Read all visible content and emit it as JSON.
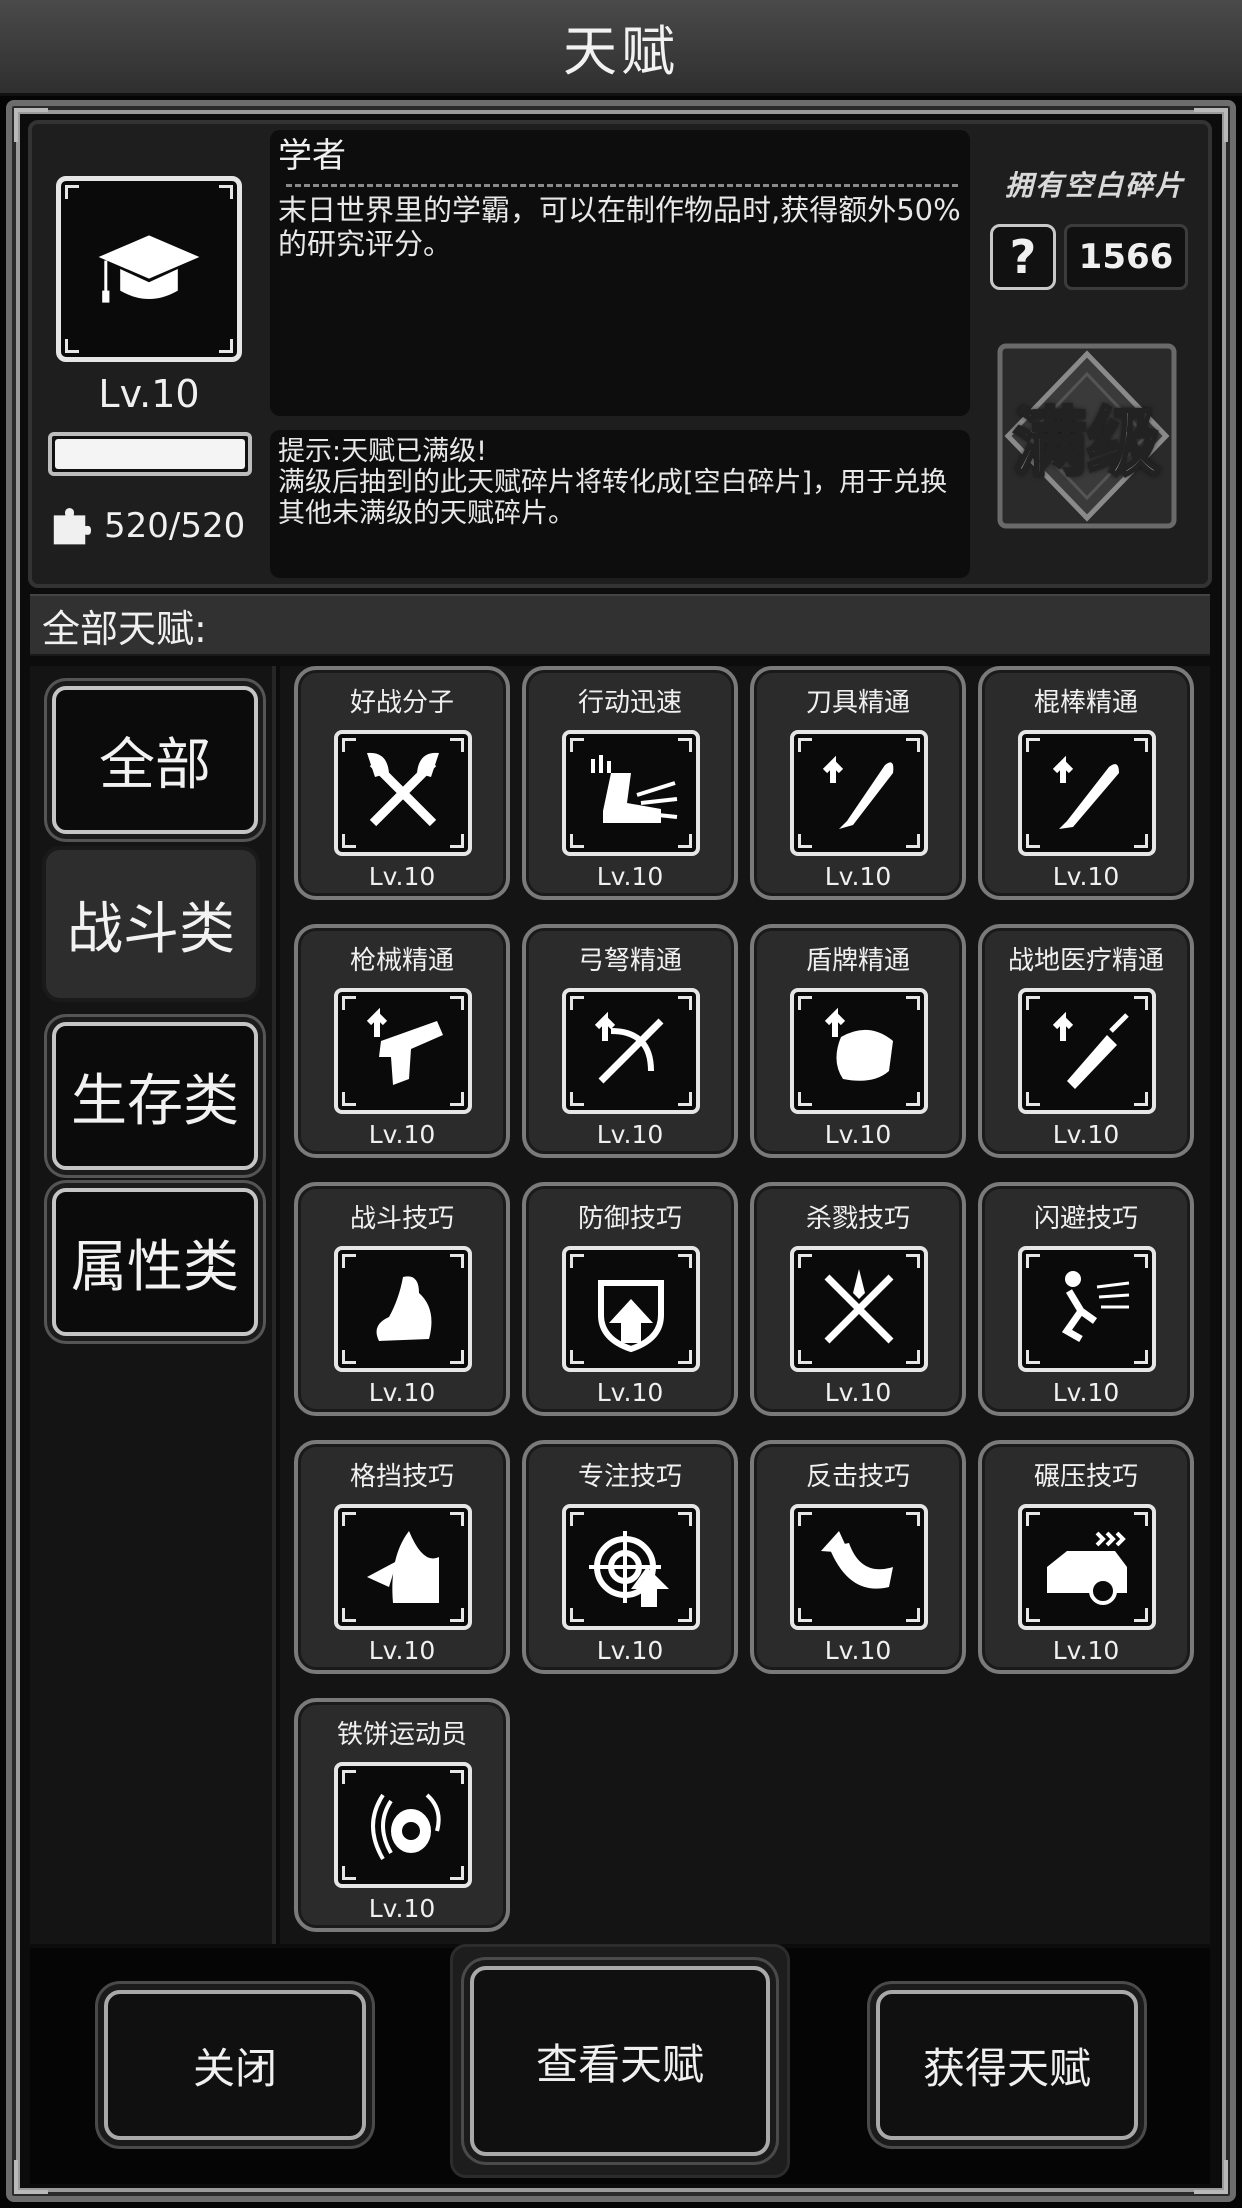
{
  "header": {
    "title": "天赋"
  },
  "selected": {
    "name": "学者",
    "description": "末日世界里的学霸，可以在制作物品时,获得额外50%的研究评分。",
    "level": "Lv.10",
    "progress_fraction": 1.0,
    "fragments": "520/520",
    "hint_line1": "提示:天赋已满级!",
    "hint_line2": "满级后抽到的此天赋碎片将转化成[空白碎片]，用于兑换其他未满级的天赋碎片。",
    "icon": "graduation-cap-icon"
  },
  "blank_fragments": {
    "title": "拥有空白碎片",
    "count": "1566",
    "icon": "question-fragment-icon"
  },
  "max_level_badge": "满级",
  "section": {
    "title": "全部天赋:"
  },
  "categories": [
    {
      "label": "全部",
      "active": false
    },
    {
      "label": "战斗类",
      "active": true
    },
    {
      "label": "生存类",
      "active": false
    },
    {
      "label": "属性类",
      "active": false
    }
  ],
  "talents": [
    {
      "name": "好战分子",
      "level": "Lv.10",
      "icon": "crossed-axes-icon"
    },
    {
      "name": "行动迅速",
      "level": "Lv.10",
      "icon": "running-boot-icon"
    },
    {
      "name": "刀具精通",
      "level": "Lv.10",
      "icon": "machete-icon"
    },
    {
      "name": "棍棒精通",
      "level": "Lv.10",
      "icon": "bat-icon"
    },
    {
      "name": "枪械精通",
      "level": "Lv.10",
      "icon": "pistol-icon"
    },
    {
      "name": "弓弩精通",
      "level": "Lv.10",
      "icon": "crossbow-icon"
    },
    {
      "name": "盾牌精通",
      "level": "Lv.10",
      "icon": "shield-icon"
    },
    {
      "name": "战地医疗精通",
      "level": "Lv.10",
      "icon": "syringe-icon"
    },
    {
      "name": "战斗技巧",
      "level": "Lv.10",
      "icon": "flexed-arm-icon"
    },
    {
      "name": "防御技巧",
      "level": "Lv.10",
      "icon": "shield-arrow-icon"
    },
    {
      "name": "杀戮技巧",
      "level": "Lv.10",
      "icon": "crossed-swords-icon"
    },
    {
      "name": "闪避技巧",
      "level": "Lv.10",
      "icon": "dodge-icon"
    },
    {
      "name": "格挡技巧",
      "level": "Lv.10",
      "icon": "block-icon"
    },
    {
      "name": "专注技巧",
      "level": "Lv.10",
      "icon": "crosshair-icon"
    },
    {
      "name": "反击技巧",
      "level": "Lv.10",
      "icon": "counter-icon"
    },
    {
      "name": "碾压技巧",
      "level": "Lv.10",
      "icon": "car-crush-icon"
    },
    {
      "name": "铁饼运动员",
      "level": "Lv.10",
      "icon": "discus-icon"
    }
  ],
  "buttons": {
    "close": "关闭",
    "view": "查看天赋",
    "obtain": "获得天赋"
  }
}
